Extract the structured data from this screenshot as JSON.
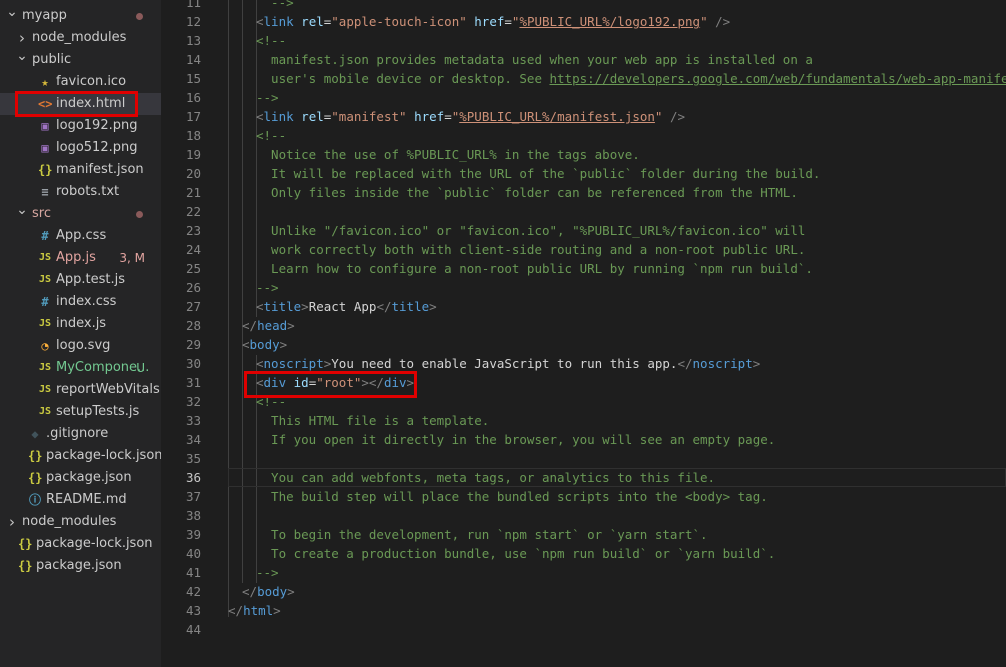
{
  "explorer": {
    "items": [
      {
        "label": "myapp",
        "type": "folder-open",
        "depth": 0,
        "dot": true
      },
      {
        "label": "node_modules",
        "type": "folder-closed",
        "depth": 1
      },
      {
        "label": "public",
        "type": "folder-open",
        "depth": 1
      },
      {
        "label": "favicon.ico",
        "type": "file",
        "icon": "★",
        "iconName": "star-icon",
        "iconColor": "#d7ba3b",
        "depth": 2
      },
      {
        "label": "index.html",
        "type": "file",
        "icon": "<>",
        "iconName": "html-icon",
        "iconColor": "#e37933",
        "depth": 2,
        "selected": true
      },
      {
        "label": "logo192.png",
        "type": "file",
        "icon": "▣",
        "iconName": "image-icon",
        "iconColor": "#a074c4",
        "depth": 2
      },
      {
        "label": "logo512.png",
        "type": "file",
        "icon": "▣",
        "iconName": "image-icon",
        "iconColor": "#a074c4",
        "depth": 2
      },
      {
        "label": "manifest.json",
        "type": "file",
        "icon": "{}",
        "iconName": "json-icon",
        "iconColor": "#cbcb41",
        "depth": 2
      },
      {
        "label": "robots.txt",
        "type": "file",
        "icon": "≡",
        "iconName": "text-file-icon",
        "iconColor": "#9aa0a6",
        "depth": 2
      },
      {
        "label": "src",
        "type": "folder-open",
        "depth": 1,
        "dot": true,
        "labelColor": "#d7a7a0"
      },
      {
        "label": "App.css",
        "type": "file",
        "icon": "#",
        "iconName": "css-icon",
        "iconColor": "#519aba",
        "depth": 2
      },
      {
        "label": "App.js",
        "type": "file",
        "icon": "JS",
        "iconName": "js-icon",
        "iconColor": "#cbcb41",
        "depth": 2,
        "labelColor": "#e2a4a0",
        "badge": "3, M",
        "badgeColor": "#e2a4a0"
      },
      {
        "label": "App.test.js",
        "type": "file",
        "icon": "JS",
        "iconName": "js-icon",
        "iconColor": "#cbcb41",
        "depth": 2
      },
      {
        "label": "index.css",
        "type": "file",
        "icon": "#",
        "iconName": "css-icon",
        "iconColor": "#519aba",
        "depth": 2
      },
      {
        "label": "index.js",
        "type": "file",
        "icon": "JS",
        "iconName": "js-icon",
        "iconColor": "#cbcb41",
        "depth": 2
      },
      {
        "label": "logo.svg",
        "type": "file",
        "icon": "◔",
        "iconName": "svg-icon",
        "iconColor": "#ffb13b",
        "depth": 2
      },
      {
        "label": "MyCompone...",
        "type": "file",
        "icon": "JS",
        "iconName": "js-icon",
        "iconColor": "#cbcb41",
        "depth": 2,
        "labelColor": "#73c991",
        "badge": "U",
        "badgeColor": "#73c991"
      },
      {
        "label": "reportWebVitals.js",
        "type": "file",
        "icon": "JS",
        "iconName": "js-icon",
        "iconColor": "#cbcb41",
        "depth": 2
      },
      {
        "label": "setupTests.js",
        "type": "file",
        "icon": "JS",
        "iconName": "js-icon",
        "iconColor": "#cbcb41",
        "depth": 2
      },
      {
        "label": ".gitignore",
        "type": "file",
        "icon": "◆",
        "iconName": "git-icon",
        "iconColor": "#41535b",
        "depth": 1
      },
      {
        "label": "package-lock.json",
        "type": "file",
        "icon": "{}",
        "iconName": "json-icon",
        "iconColor": "#cbcb41",
        "depth": 1
      },
      {
        "label": "package.json",
        "type": "file",
        "icon": "{}",
        "iconName": "json-icon",
        "iconColor": "#cbcb41",
        "depth": 1
      },
      {
        "label": "README.md",
        "type": "file",
        "icon": "ⓘ",
        "iconName": "info-icon",
        "iconColor": "#519aba",
        "depth": 1
      },
      {
        "label": "node_modules",
        "type": "folder-closed",
        "depth": 0
      },
      {
        "label": "package-lock.json",
        "type": "file",
        "icon": "{}",
        "iconName": "json-icon",
        "iconColor": "#cbcb41",
        "depth": 0
      },
      {
        "label": "package.json",
        "type": "file",
        "icon": "{}",
        "iconName": "json-icon",
        "iconColor": "#cbcb41",
        "depth": 0
      }
    ]
  },
  "editor": {
    "currentLine": 36,
    "lines": [
      {
        "n": "11",
        "t": [
          [
            "cm",
            "  -->"
          ]
        ],
        "indent": 2
      },
      {
        "n": "12",
        "t": [
          [
            "pu",
            "<"
          ],
          [
            "tg",
            "link"
          ],
          [
            "",
            ""
          ],
          [
            "at",
            " rel"
          ],
          [
            "",
            "="
          ],
          [
            "st",
            "\"apple-touch-icon\""
          ],
          [
            "at",
            " href"
          ],
          [
            "",
            "="
          ],
          [
            "st",
            "\""
          ],
          [
            "stu",
            "%PUBLIC_URL%/logo192.png"
          ],
          [
            "st",
            "\""
          ],
          [
            "pu",
            " />"
          ]
        ],
        "indent": 2
      },
      {
        "n": "13",
        "t": [
          [
            "cm",
            "<!--"
          ]
        ],
        "indent": 2
      },
      {
        "n": "14",
        "t": [
          [
            "cm",
            "  manifest.json provides metadata used when your web app is installed on a"
          ]
        ],
        "indent": 2
      },
      {
        "n": "15",
        "t": [
          [
            "cm",
            "  user's mobile device or desktop. See "
          ],
          [
            "cmu",
            "https://developers.google.com/web/fundamentals/web-app-manifest/"
          ]
        ],
        "indent": 2
      },
      {
        "n": "16",
        "t": [
          [
            "cm",
            "-->"
          ]
        ],
        "indent": 2
      },
      {
        "n": "17",
        "t": [
          [
            "pu",
            "<"
          ],
          [
            "tg",
            "link"
          ],
          [
            "at",
            " rel"
          ],
          [
            "",
            "="
          ],
          [
            "st",
            "\"manifest\""
          ],
          [
            "at",
            " href"
          ],
          [
            "",
            "="
          ],
          [
            "st",
            "\""
          ],
          [
            "stu",
            "%PUBLIC_URL%/manifest.json"
          ],
          [
            "st",
            "\""
          ],
          [
            "pu",
            " />"
          ]
        ],
        "indent": 2
      },
      {
        "n": "18",
        "t": [
          [
            "cm",
            "<!--"
          ]
        ],
        "indent": 2
      },
      {
        "n": "19",
        "t": [
          [
            "cm",
            "  Notice the use of %PUBLIC_URL% in the tags above."
          ]
        ],
        "indent": 2
      },
      {
        "n": "20",
        "t": [
          [
            "cm",
            "  It will be replaced with the URL of the `public` folder during the build."
          ]
        ],
        "indent": 2
      },
      {
        "n": "21",
        "t": [
          [
            "cm",
            "  Only files inside the `public` folder can be referenced from the HTML."
          ]
        ],
        "indent": 2
      },
      {
        "n": "22",
        "t": [],
        "indent": 2
      },
      {
        "n": "23",
        "t": [
          [
            "cm",
            "  Unlike \"/favicon.ico\" or \"favicon.ico\", \"%PUBLIC_URL%/favicon.ico\" will"
          ]
        ],
        "indent": 2
      },
      {
        "n": "24",
        "t": [
          [
            "cm",
            "  work correctly both with client-side routing and a non-root public URL."
          ]
        ],
        "indent": 2
      },
      {
        "n": "25",
        "t": [
          [
            "cm",
            "  Learn how to configure a non-root public URL by running `npm run build`."
          ]
        ],
        "indent": 2
      },
      {
        "n": "26",
        "t": [
          [
            "cm",
            "-->"
          ]
        ],
        "indent": 2
      },
      {
        "n": "27",
        "t": [
          [
            "pu",
            "<"
          ],
          [
            "tg",
            "title"
          ],
          [
            "pu",
            ">"
          ],
          [
            "",
            "React App"
          ],
          [
            "pu",
            "</"
          ],
          [
            "tg",
            "title"
          ],
          [
            "pu",
            ">"
          ]
        ],
        "indent": 2
      },
      {
        "n": "28",
        "t": [
          [
            "pu",
            "</"
          ],
          [
            "tg",
            "head"
          ],
          [
            "pu",
            ">"
          ]
        ],
        "indent": 1
      },
      {
        "n": "29",
        "t": [
          [
            "pu",
            "<"
          ],
          [
            "tg",
            "body"
          ],
          [
            "pu",
            ">"
          ]
        ],
        "indent": 1
      },
      {
        "n": "30",
        "t": [
          [
            "pu",
            "<"
          ],
          [
            "tg",
            "noscript"
          ],
          [
            "pu",
            ">"
          ],
          [
            "",
            "You need to enable JavaScript to run this app."
          ],
          [
            "pu",
            "</"
          ],
          [
            "tg",
            "noscript"
          ],
          [
            "pu",
            ">"
          ]
        ],
        "indent": 2
      },
      {
        "n": "31",
        "t": [
          [
            "pu",
            "<"
          ],
          [
            "tg",
            "div"
          ],
          [
            "at",
            " id"
          ],
          [
            "",
            "="
          ],
          [
            "st",
            "\"root\""
          ],
          [
            "pu",
            "></"
          ],
          [
            "tg",
            "div"
          ],
          [
            "pu",
            ">"
          ]
        ],
        "indent": 2
      },
      {
        "n": "32",
        "t": [
          [
            "cm",
            "<!--"
          ]
        ],
        "indent": 2
      },
      {
        "n": "33",
        "t": [
          [
            "cm",
            "  This HTML file is a template."
          ]
        ],
        "indent": 2
      },
      {
        "n": "34",
        "t": [
          [
            "cm",
            "  If you open it directly in the browser, you will see an empty page."
          ]
        ],
        "indent": 2
      },
      {
        "n": "35",
        "t": [],
        "indent": 2
      },
      {
        "n": "36",
        "t": [
          [
            "cm",
            "  You can add webfonts, meta tags, or analytics to this file."
          ]
        ],
        "indent": 2
      },
      {
        "n": "37",
        "t": [
          [
            "cm",
            "  The build step will place the bundled scripts into the <body> tag."
          ]
        ],
        "indent": 2
      },
      {
        "n": "38",
        "t": [],
        "indent": 2
      },
      {
        "n": "39",
        "t": [
          [
            "cm",
            "  To begin the development, run `npm start` or `yarn start`."
          ]
        ],
        "indent": 2
      },
      {
        "n": "40",
        "t": [
          [
            "cm",
            "  To create a production bundle, use `npm run build` or `yarn build`."
          ]
        ],
        "indent": 2
      },
      {
        "n": "41",
        "t": [
          [
            "cm",
            "-->"
          ]
        ],
        "indent": 2
      },
      {
        "n": "42",
        "t": [
          [
            "pu",
            "</"
          ],
          [
            "tg",
            "body"
          ],
          [
            "pu",
            ">"
          ]
        ],
        "indent": 1
      },
      {
        "n": "43",
        "t": [
          [
            "pu",
            "</"
          ],
          [
            "tg",
            "html"
          ],
          [
            "pu",
            ">"
          ]
        ],
        "indent": 0
      },
      {
        "n": "44",
        "t": [],
        "indent": 0
      }
    ]
  }
}
